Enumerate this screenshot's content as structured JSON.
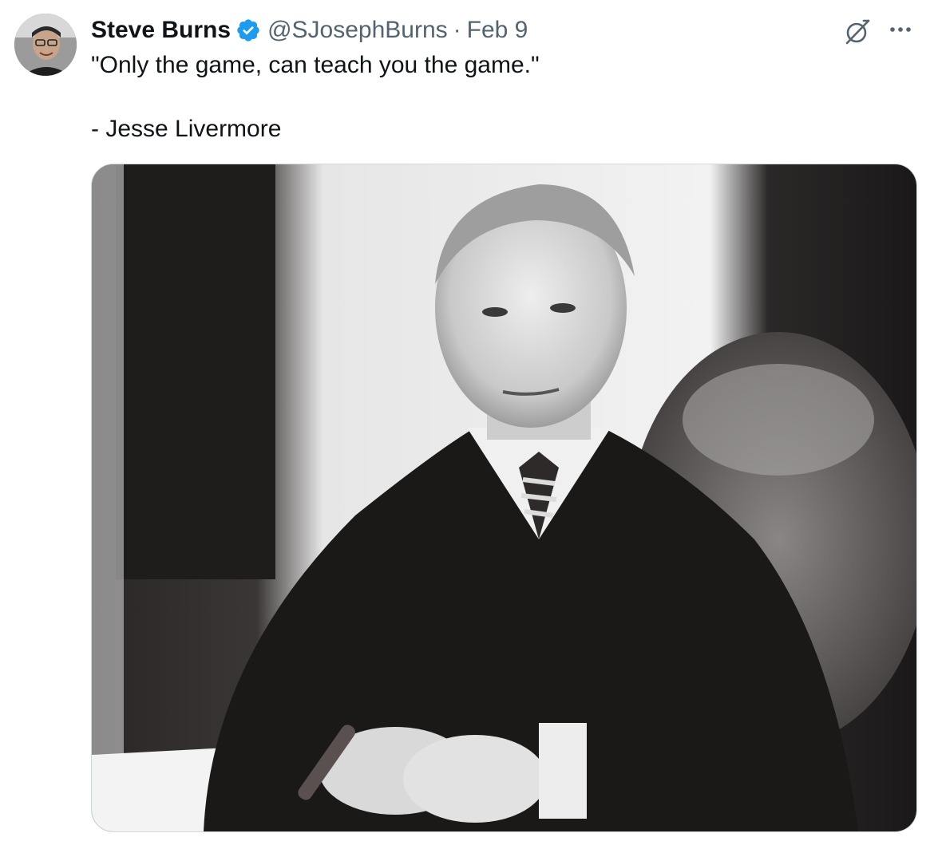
{
  "tweet": {
    "author": {
      "name": "Steve Burns",
      "handle": "@SJosephBurns",
      "verified": true,
      "avatar": "profile-photo"
    },
    "separator": "·",
    "date": "Feb 9",
    "text_lines": [
      "\"Only the game, can teach you the game.\"",
      "- Jesse Livermore"
    ],
    "media": {
      "type": "photo",
      "description_icon": "black-and-white-portrait-photo"
    },
    "actions": {
      "grok_icon": "grok-icon",
      "more_icon": "more-horizontal-icon"
    }
  },
  "colors": {
    "text_primary": "#0f1419",
    "text_secondary": "#536471",
    "verified_blue": "#1d9bf0",
    "media_border": "#cfd9de"
  }
}
